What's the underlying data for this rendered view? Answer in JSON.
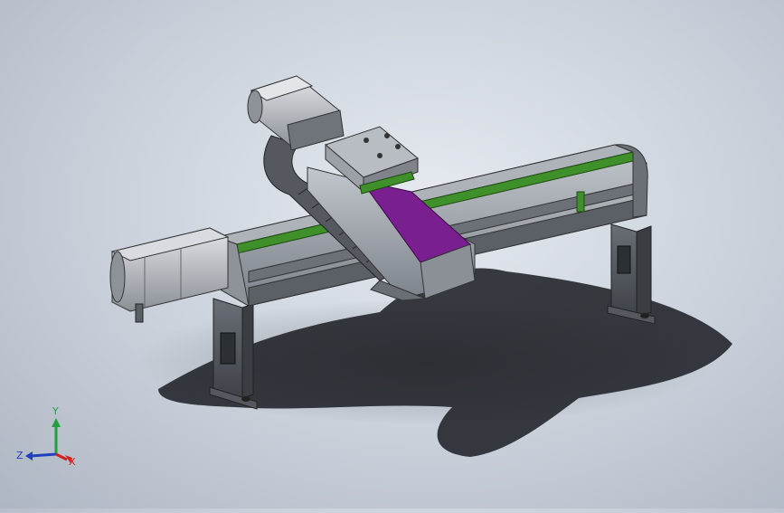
{
  "viewport": {
    "background_top": "#e6eaf0",
    "background_bottom": "#aeb6c3"
  },
  "model": {
    "rail_color": "#3f8f2a",
    "carriage_color": "#7a1f8f",
    "body_color": "#9aa0a6",
    "dark_color": "#4a4e54"
  },
  "triad": {
    "x_label": "X",
    "y_label": "Y",
    "z_label": "Z",
    "x_color": "#d42020",
    "y_color": "#20a040",
    "z_color": "#2040c0"
  }
}
